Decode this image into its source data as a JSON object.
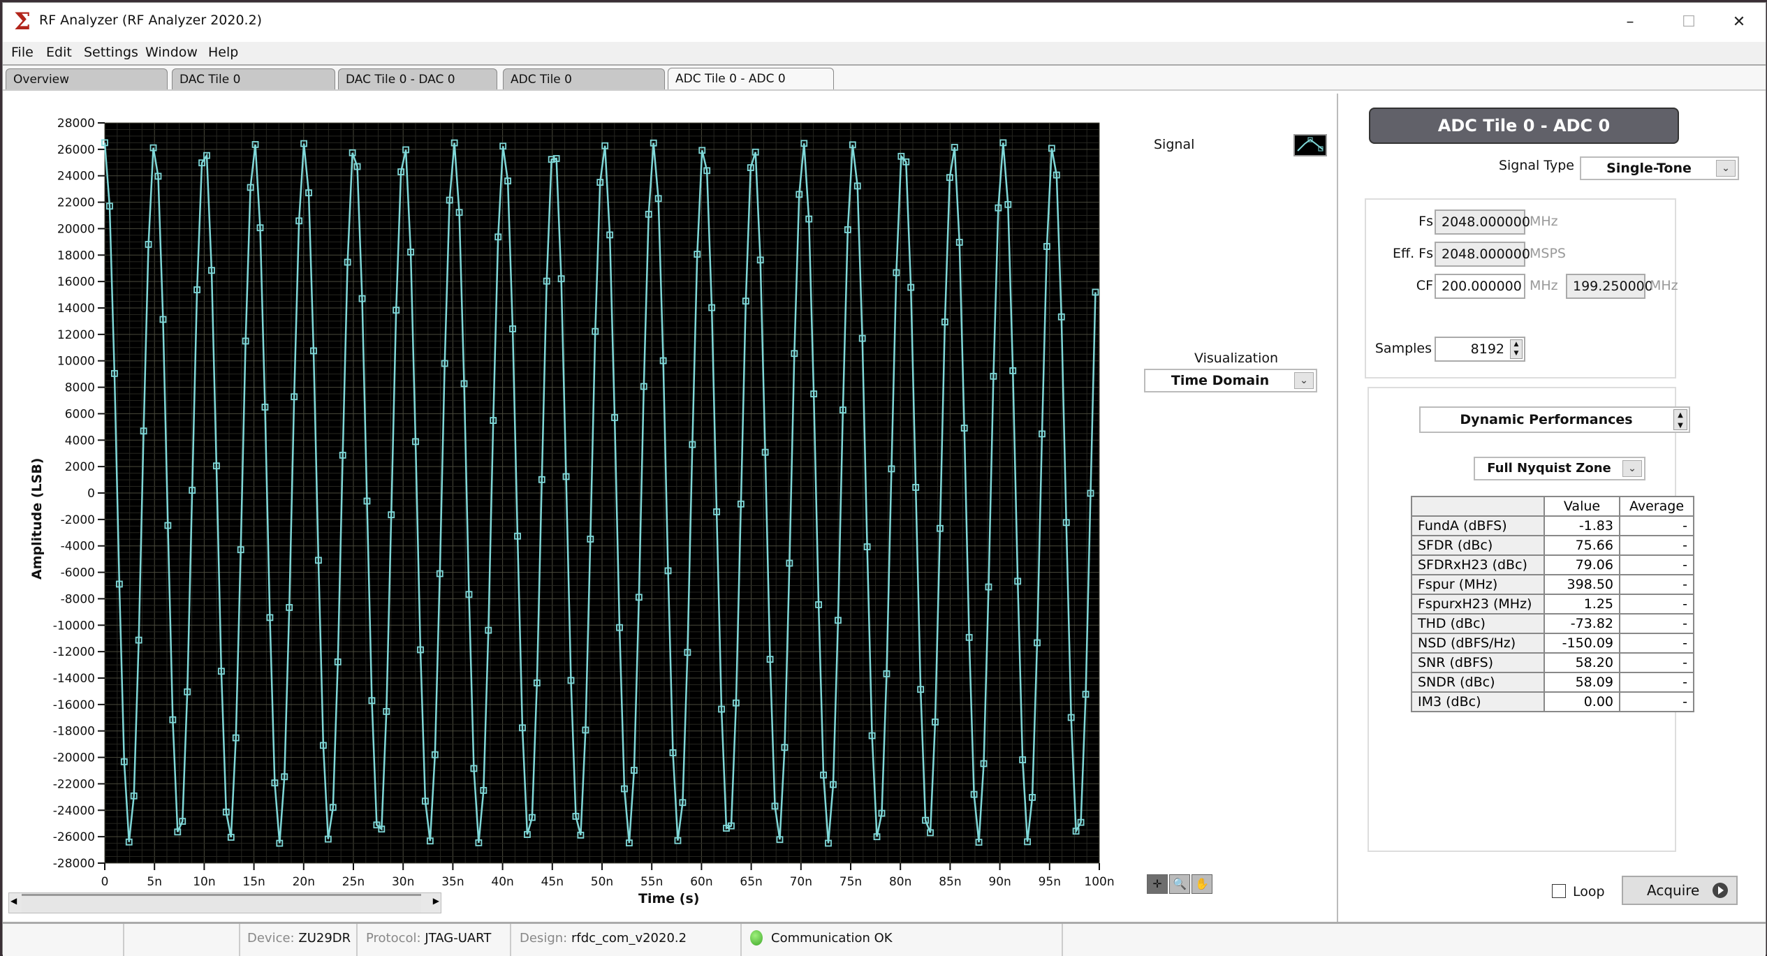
{
  "window": {
    "title": "RF Analyzer (RF Analyzer 2020.2)",
    "logo_icon": "xilinx-sigma-logo",
    "controls": {
      "minimize": "–",
      "maximize": "☐",
      "close": "✕"
    }
  },
  "menu": [
    "File",
    "Edit",
    "Settings",
    "Window",
    "Help"
  ],
  "tabs": [
    {
      "label": "Overview",
      "active": false
    },
    {
      "label": "DAC Tile 0",
      "active": false
    },
    {
      "label": "DAC Tile 0 - DAC 0",
      "active": false
    },
    {
      "label": "ADC Tile 0",
      "active": false
    },
    {
      "label": "ADC Tile 0 - ADC 0",
      "active": true
    }
  ],
  "plot": {
    "legend_label": "Signal",
    "visualization_label": "Visualization",
    "visualization_value": "Time Domain",
    "tools": [
      "cursor-tool",
      "zoom-tool",
      "pan-tool"
    ]
  },
  "chart_data": {
    "type": "line",
    "title": "",
    "xlabel": "Time (s)",
    "ylabel": "Amplitude (LSB)",
    "xlim": [
      0,
      1e-07
    ],
    "ylim": [
      -28000,
      28000
    ],
    "x_ticks": [
      "0",
      "5n",
      "10n",
      "15n",
      "20n",
      "25n",
      "30n",
      "35n",
      "40n",
      "45n",
      "50n",
      "55n",
      "60n",
      "65n",
      "70n",
      "75n",
      "80n",
      "85n",
      "90n",
      "95n",
      "100n"
    ],
    "y_ticks": [
      28000,
      26000,
      24000,
      22000,
      20000,
      18000,
      16000,
      14000,
      12000,
      10000,
      8000,
      6000,
      4000,
      2000,
      0,
      -2000,
      -4000,
      -6000,
      -8000,
      -10000,
      -12000,
      -14000,
      -16000,
      -18000,
      -20000,
      -22000,
      -24000,
      -26000,
      -28000
    ],
    "grid": true,
    "series": [
      {
        "name": "Signal",
        "color": "#7fd8d8",
        "marker": "square",
        "generator": {
          "kind": "sine",
          "sample_rate_hz": 2048000000,
          "frequency_hz": 199250000,
          "amplitude_lsb": 26500,
          "phase_rad": 0.0,
          "duration_s": 1e-07
        }
      }
    ]
  },
  "scrollbar": {
    "left_arrow": "◀",
    "right_arrow": "▶"
  },
  "panel": {
    "header": "ADC Tile 0 - ADC 0",
    "signal_type_label": "Signal Type",
    "signal_type_value": "Single-Tone",
    "fs_label": "Fs",
    "fs_value": "2048.000000",
    "fs_unit": "MHz",
    "eff_fs_label": "Eff. Fs",
    "eff_fs_value": "2048.000000",
    "eff_fs_unit": "MSPS",
    "cf_label": "CF",
    "cf_value": "200.000000",
    "cf_unit": "MHz",
    "cf_actual_value": "199.250000",
    "cf_actual_unit": "MHz",
    "samples_label": "Samples",
    "samples_value": "8192",
    "metrics_selector": "Dynamic Performances",
    "zone_selector": "Full Nyquist Zone",
    "table": {
      "headers": [
        "",
        "Value",
        "Average"
      ],
      "rows": [
        {
          "name": "FundA (dBFS)",
          "value": "-1.83",
          "average": "-"
        },
        {
          "name": "SFDR (dBc)",
          "value": "75.66",
          "average": "-"
        },
        {
          "name": "SFDRxH23 (dBc)",
          "value": "79.06",
          "average": "-"
        },
        {
          "name": "Fspur (MHz)",
          "value": "398.50",
          "average": "-"
        },
        {
          "name": "FspurxH23 (MHz)",
          "value": "1.25",
          "average": "-"
        },
        {
          "name": "THD (dBc)",
          "value": "-73.82",
          "average": "-"
        },
        {
          "name": "NSD (dBFS/Hz)",
          "value": "-150.09",
          "average": "-"
        },
        {
          "name": "SNR (dBFS)",
          "value": "58.20",
          "average": "-"
        },
        {
          "name": "SNDR (dBc)",
          "value": "58.09",
          "average": "-"
        },
        {
          "name": "IM3 (dBc)",
          "value": "0.00",
          "average": "-"
        }
      ]
    },
    "loop_label": "Loop",
    "loop_checked": false,
    "acquire_label": "Acquire"
  },
  "status": {
    "device_key": "Device:",
    "device_value": "ZU29DR",
    "protocol_key": "Protocol:",
    "protocol_value": "JTAG-UART",
    "design_key": "Design:",
    "design_value": "rfdc_com_v2020.2",
    "connection_text": "Communication OK",
    "connection_color": "#4cbb32"
  }
}
